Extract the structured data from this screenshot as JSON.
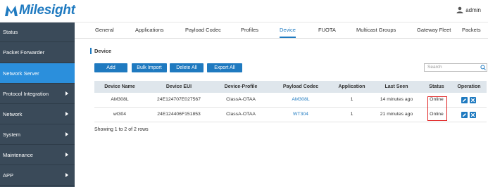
{
  "brand": {
    "name": "Milesight",
    "color": "#1f7ac0"
  },
  "user": {
    "name": "admin"
  },
  "sidebar": {
    "items": [
      {
        "label": "Status",
        "has_arrow": false,
        "active": false
      },
      {
        "label": "Packet Forwarder",
        "has_arrow": false,
        "active": false
      },
      {
        "label": "Network Server",
        "has_arrow": false,
        "active": true
      },
      {
        "label": "Protocol Integration",
        "has_arrow": true,
        "active": false
      },
      {
        "label": "Network",
        "has_arrow": true,
        "active": false
      },
      {
        "label": "System",
        "has_arrow": true,
        "active": false
      },
      {
        "label": "Maintenance",
        "has_arrow": true,
        "active": false
      },
      {
        "label": "APP",
        "has_arrow": true,
        "active": false
      }
    ]
  },
  "tabs": [
    {
      "label": "General"
    },
    {
      "label": "Applications"
    },
    {
      "label": "Payload Codec"
    },
    {
      "label": "Profiles"
    },
    {
      "label": "Device",
      "active": true
    },
    {
      "label": "FUOTA"
    },
    {
      "label": "Multicast Groups"
    },
    {
      "label": "Gateway Fleet"
    },
    {
      "label": "Packets"
    }
  ],
  "main": {
    "title": "Device",
    "buttons": {
      "add": "Add",
      "bulk_import": "Bulk Import",
      "delete_all": "Delete All",
      "export_all": "Export All"
    },
    "search": {
      "placeholder": "Search"
    },
    "table": {
      "columns": [
        "Device Name",
        "Device EUI",
        "Device-Profile",
        "Payload Codec",
        "Application",
        "Last Seen",
        "Status",
        "Operation"
      ],
      "rows": [
        {
          "name": "AM308L",
          "eui": "24E124707E027567",
          "profile": "ClassA-OTAA",
          "codec": "AM308L",
          "application": "1",
          "last_seen": "14 minutes ago",
          "status": "Online"
        },
        {
          "name": "wt304",
          "eui": "24E124406F151853",
          "profile": "ClassA-OTAA",
          "codec": "WT304",
          "application": "1",
          "last_seen": "21 minutes ago",
          "status": "Online"
        }
      ]
    },
    "footer": "Showing 1 to 2 of 2 rows"
  }
}
